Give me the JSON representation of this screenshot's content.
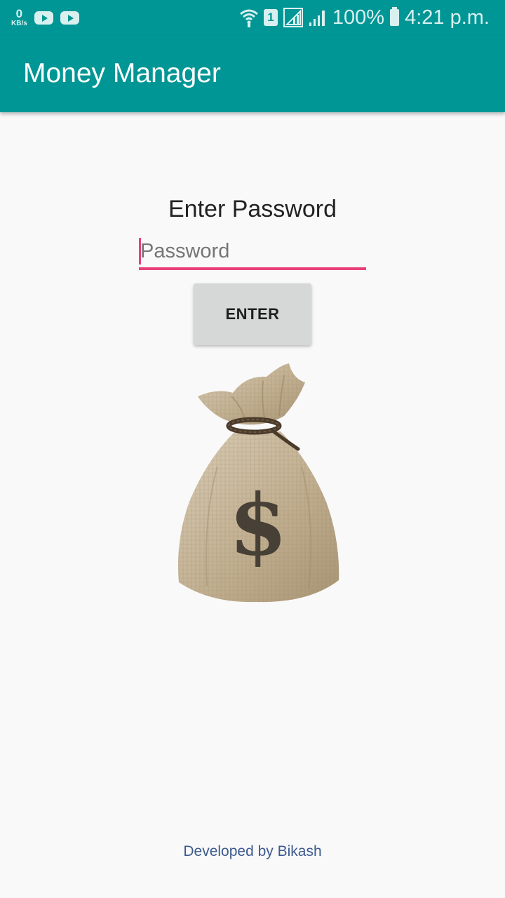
{
  "status_bar": {
    "speed_value": "0",
    "speed_unit": "KB/s",
    "notification_icons": [
      "youtube-icon",
      "youtube-icon"
    ],
    "sim_slot": "1",
    "battery": "100%",
    "time": "4:21 p.m."
  },
  "app_bar": {
    "title": "Money Manager",
    "color": "#009695"
  },
  "login": {
    "prompt": "Enter Password",
    "password_placeholder": "Password",
    "password_value": "",
    "enter_label": "ENTER",
    "accent_color": "#e9407a"
  },
  "illustration": {
    "icon": "money-bag-icon"
  },
  "footer": {
    "credit": "Developed by Bikash"
  }
}
